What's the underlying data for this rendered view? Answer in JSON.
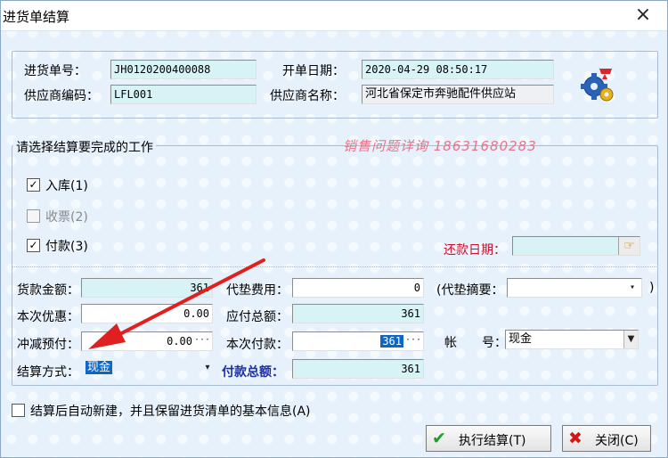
{
  "window": {
    "title": "进货单结算",
    "close_glyph": "×"
  },
  "header": {
    "order_no_label": "进货单号：",
    "order_no_value": "JH0120200400088",
    "open_date_label": "开单日期：",
    "open_date_value": "2020-04-29 08:50:17",
    "supplier_code_label": "供应商编码：",
    "supplier_code_value": "LFL001",
    "supplier_name_label": "供应商名称：",
    "supplier_name_value": "河北省保定市奔驰配件供应站"
  },
  "group": {
    "title": "请选择结算要完成的工作"
  },
  "watermark": "销售问题详询 18631680283",
  "tasks": [
    {
      "label": "入库(1)",
      "checked": true,
      "enabled": true,
      "mark": "✓"
    },
    {
      "label": "收票(2)",
      "checked": false,
      "enabled": false,
      "mark": ""
    },
    {
      "label": "付款(3)",
      "checked": true,
      "enabled": true,
      "mark": "✓"
    }
  ],
  "repay_date": {
    "label": "还款日期：",
    "value": "",
    "button_glyph": "☞"
  },
  "amounts": {
    "goods_amount_label": "货款金额：",
    "goods_amount_value": "361",
    "advance_fee_label": "代垫费用：",
    "advance_fee_value": "0",
    "advance_summary_label": "(代垫摘要：",
    "advance_summary_value": "",
    "discount_label": "本次优惠：",
    "discount_value": "0.00",
    "payable_total_label": "应付总额：",
    "payable_total_value": "361",
    "prepay_offset_label": "冲减预付：",
    "prepay_offset_value": "0.00",
    "this_payment_label": "本次付款：",
    "this_payment_value": "361",
    "account_label": "帐　　号：",
    "account_value": "现金",
    "settle_method_label": "结算方式：",
    "settle_method_value": "现金",
    "payment_total_label": "付款总额：",
    "payment_total_value": "361"
  },
  "auto_new": {
    "label": "结算后自动新建，并且保留进货清单的基本信息(A)",
    "checked": false
  },
  "buttons": {
    "execute_label": "执行结算(T)",
    "execute_icon": "✔",
    "close_label": "关闭(C)",
    "close_icon": "✖"
  },
  "colors": {
    "background": "#e6f1fb",
    "field_cyan": "#d7f3f5",
    "label_red": "#c8102e",
    "label_blue": "#1b2fa6",
    "arrow_red": "#e02020",
    "selection": "#0a67c9"
  }
}
